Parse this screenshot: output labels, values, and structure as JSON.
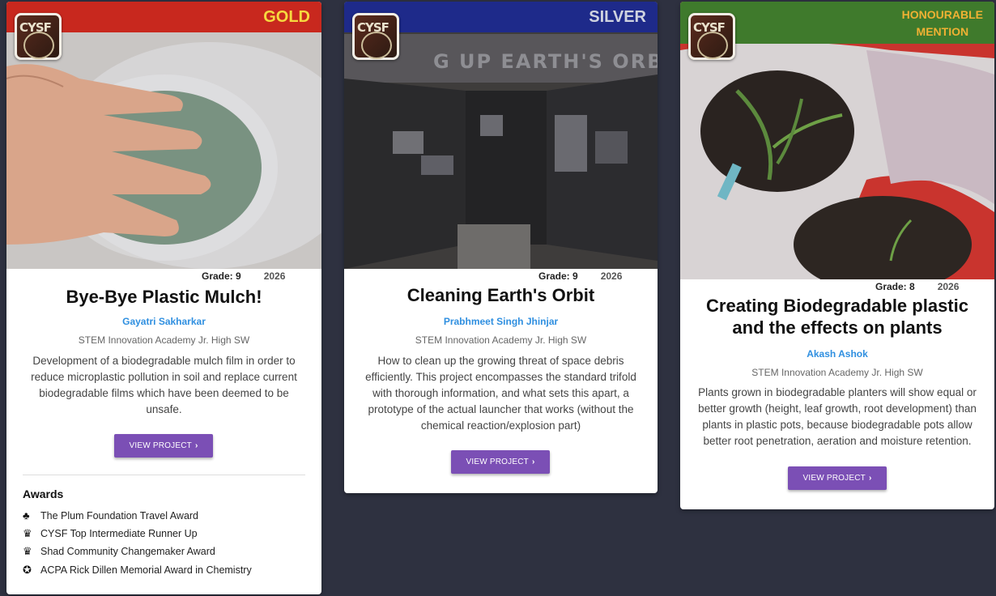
{
  "cards": [
    {
      "place": "GOLD",
      "banner_color": "#c8281e",
      "place_color": "#f6d93f",
      "logo_text": "CYSF",
      "grade": "Grade: 9",
      "year": "2026",
      "title": "Bye-Bye Plastic Mulch!",
      "author": "Gayatri Sakharkar",
      "school": "STEM Innovation Academy Jr. High SW",
      "description": "Development of a biodegradable mulch film in order to reduce microplastic pollution in soil and replace current biodegradable films which have been deemed to be unsafe.",
      "button": "VIEW PROJECT",
      "awards_heading": "Awards",
      "awards": [
        {
          "icon": "maple-leaf-icon",
          "glyph": "♣",
          "label": "The Plum Foundation Travel Award"
        },
        {
          "icon": "trophy-icon",
          "glyph": "🏆",
          "label": "CYSF Top Intermediate Runner Up"
        },
        {
          "icon": "trophy-icon",
          "glyph": "🏆",
          "label": "Shad Community Changemaker Award"
        },
        {
          "icon": "ribbon-icon",
          "glyph": "✪",
          "label": "ACPA Rick Dillen Memorial Award in Chemistry"
        }
      ]
    },
    {
      "place": "SILVER",
      "banner_color": "#1e2a8a",
      "place_color": "#cfd3e0",
      "logo_text": "CYSF",
      "grade": "Grade: 9",
      "year": "2026",
      "title": "Cleaning Earth's Orbit",
      "author": "Prabhmeet Singh Jhinjar",
      "school": "STEM Innovation Academy Jr. High SW",
      "description": "How to clean up the growing threat of space debris efficiently. This project encompasses the standard trifold with thorough information, and what sets this apart, a prototype of the actual launcher that works (without the chemical reaction/explosion part)",
      "button": "VIEW PROJECT"
    },
    {
      "place": "HONOURABLE MENTION",
      "place_line1": "HONOURABLE",
      "place_line2": "MENTION",
      "banner_color": "#3f7a2c",
      "place_color": "#f0b133",
      "logo_text": "CYSF",
      "grade": "Grade: 8",
      "year": "2026",
      "title_line1": "Creating Biodegradable plastic",
      "title_line2": "and the effects on plants",
      "author": "Akash Ashok",
      "school": "STEM Innovation Academy Jr. High SW",
      "description": "Plants grown in biodegradable planters will show equal or better growth (height, leaf growth, root development) than plants in plastic pots, because biodegradable pots allow better root penetration, aeration and moisture retention.",
      "button": "VIEW PROJECT"
    }
  ]
}
